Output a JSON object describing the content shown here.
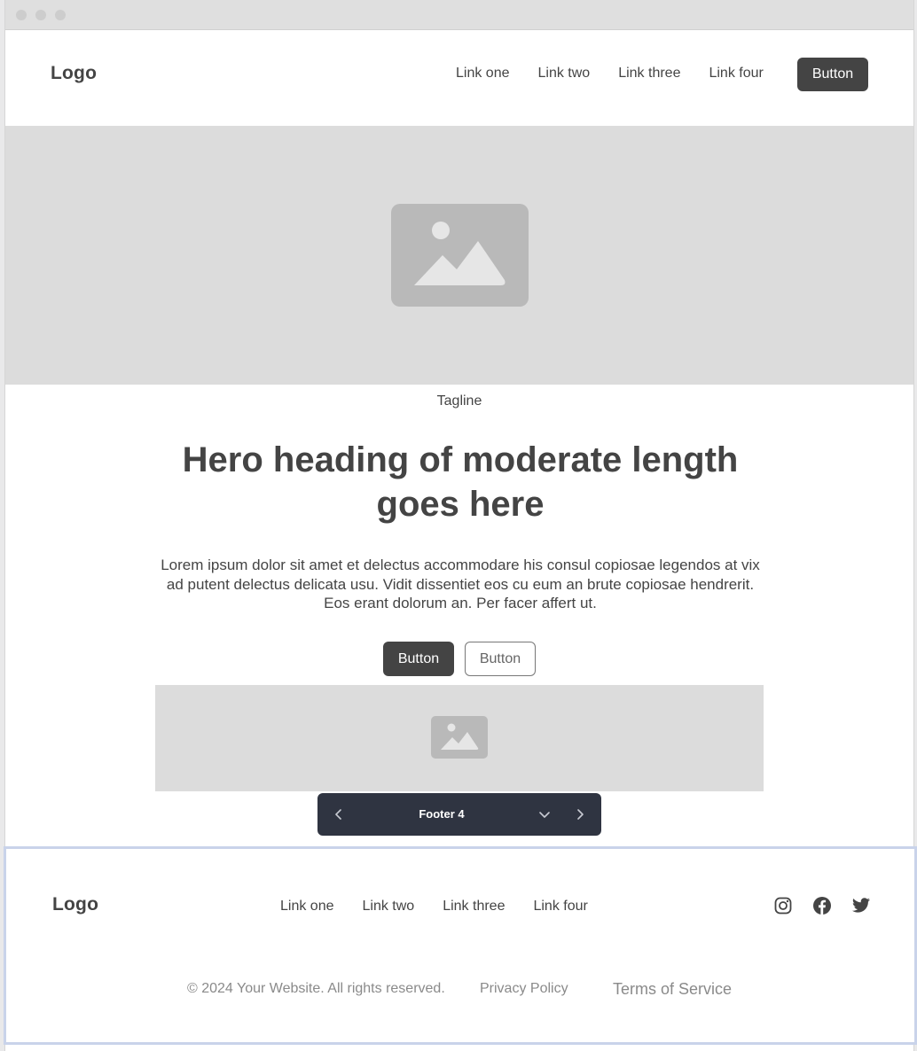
{
  "nav": {
    "logo": "Logo",
    "links": [
      "Link one",
      "Link two",
      "Link three",
      "Link four"
    ],
    "button_label": "Button"
  },
  "hero": {
    "tagline": "Tagline",
    "heading": "Hero heading of moderate length goes here",
    "body": "Lorem ipsum dolor sit amet et delectus accommodare his consul copiosae legendos at vix ad putent delectus delicata usu. Vidit dissentiet eos cu eum an brute copiosae hendrerit. Eos erant dolorum an. Per facer affert ut.",
    "primary_button": "Button",
    "secondary_button": "Button"
  },
  "toolbar": {
    "label": "Footer 4",
    "icons": [
      "chevron-left-icon",
      "chevron-down-icon",
      "chevron-right-icon"
    ]
  },
  "footer": {
    "logo": "Logo",
    "links": [
      "Link one",
      "Link two",
      "Link three",
      "Link four"
    ],
    "social_icons": [
      "instagram-icon",
      "facebook-icon",
      "twitter-icon"
    ],
    "copyright": "© 2024 Your Website. All rights reserved.",
    "privacy": "Privacy Policy",
    "terms": "Terms of Service"
  },
  "colors": {
    "primary": "#444444",
    "placeholder_bg": "#dcdcdc",
    "placeholder_icon": "#b9b9b9",
    "toolbar_bg": "#2f3441",
    "footer_border": "#c9d3ea"
  }
}
